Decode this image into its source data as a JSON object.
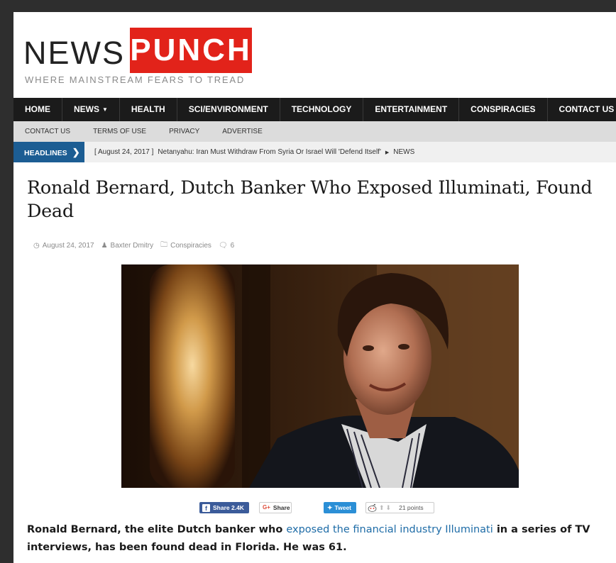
{
  "logo": {
    "news": "NEWS",
    "punch": "PUNCH",
    "tagline": "WHERE MAINSTREAM FEARS TO TREAD"
  },
  "main_nav": {
    "items": [
      {
        "label": "HOME"
      },
      {
        "label": "NEWS"
      },
      {
        "label": "HEALTH"
      },
      {
        "label": "SCI/ENVIRONMENT"
      },
      {
        "label": "TECHNOLOGY"
      },
      {
        "label": "ENTERTAINMENT"
      },
      {
        "label": "CONSPIRACIES"
      },
      {
        "label": "CONTACT US"
      }
    ]
  },
  "sub_nav": {
    "items": [
      {
        "label": "CONTACT US"
      },
      {
        "label": "TERMS OF USE"
      },
      {
        "label": "PRIVACY"
      },
      {
        "label": "ADVERTISE"
      }
    ]
  },
  "ticker": {
    "label": "HEADLINES",
    "date": "[ August 24, 2017 ]",
    "headline": "Netanyahu: Iran Must Withdraw From Syria Or Israel Will 'Defend Itself'",
    "category": "NEWS"
  },
  "article": {
    "title": "Ronald Bernard, Dutch Banker Who Exposed Illuminati, Found Dead",
    "meta": {
      "date": "August 24, 2017",
      "author": "Baxter Dmitry",
      "category": "Conspiracies",
      "comments": "6"
    },
    "lead_part1": "Ronald Bernard, the elite Dutch banker who ",
    "lead_link": "exposed the financial industry Illuminati",
    "lead_part2": " in a series of TV interviews, has been found dead in Florida. He was 61."
  },
  "share": {
    "facebook": "Share 2.4K",
    "google": "Share",
    "twitter": "Tweet",
    "reddit_points": "21 points"
  },
  "icons": {
    "nav_caret": "chevron-down-icon",
    "ticker_chevron": "chevron-right-icon",
    "date": "clock-icon",
    "author": "user-icon",
    "category": "folder-icon",
    "comments": "comment-icon"
  },
  "colors": {
    "brand_red": "#e2231a",
    "nav_bg": "#1b1b1b",
    "ticker_blue": "#1c5d93",
    "link_blue": "#1e6ca7",
    "facebook": "#3b5b9a",
    "twitter": "#2b8fd6"
  }
}
